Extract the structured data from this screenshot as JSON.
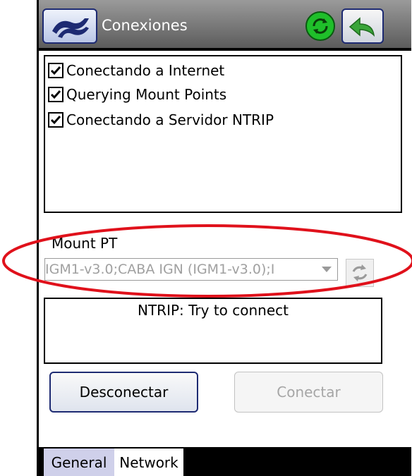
{
  "header": {
    "title": "Conexiones"
  },
  "status_list": {
    "items": [
      {
        "label": "Conectando a Internet",
        "checked": true
      },
      {
        "label": "Querying Mount Points",
        "checked": true
      },
      {
        "label": "Conectando a Servidor NTRIP",
        "checked": true
      }
    ]
  },
  "mount": {
    "label": "Mount PT",
    "selected": "IGM1-v3.0;CABA IGN (IGM1-v3.0);I"
  },
  "status": {
    "text": "NTRIP: Try to connect"
  },
  "buttons": {
    "disconnect": "Desconectar",
    "connect": "Conectar"
  },
  "tabs": [
    {
      "label": "General"
    },
    {
      "label": "Network"
    }
  ],
  "colors": {
    "annotation_circle": "#e0111b",
    "sync_icon": "#1fbf2a",
    "back_arrow": "#3aa53a",
    "brand": "#1d2a72"
  }
}
